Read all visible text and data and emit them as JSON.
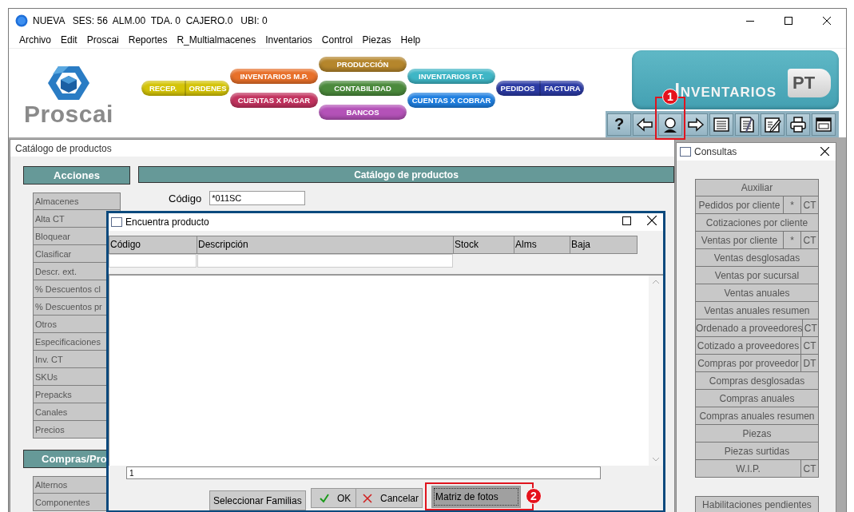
{
  "window": {
    "title": "NUEVA   SES: 56  ALM.00  TDA. 0  CAJERO.0   UBI: 0"
  },
  "menu": [
    "Archivo",
    "Edit",
    "Proscai",
    "Reportes",
    "R_Multialmacenes",
    "Inventarios",
    "Control",
    "Piezas",
    "Help"
  ],
  "logo": {
    "text": "Proscai"
  },
  "module_columns": [
    [
      {
        "labels": [
          "RECEP.",
          "ORDENES"
        ],
        "color": "#d4c408"
      }
    ],
    [
      {
        "labels": [
          "INVENTARIOS M.P."
        ],
        "color": "#e8702a"
      },
      {
        "labels": [
          "CUENTAS X PAGAR"
        ],
        "color": "#c2335f"
      }
    ],
    [
      {
        "labels": [
          "PRODUCCIÓN"
        ],
        "color": "#b5862c"
      },
      {
        "labels": [
          "CONTABILIDAD"
        ],
        "color": "#4b8a3c"
      },
      {
        "labels": [
          "BANCOS"
        ],
        "color": "#b452b8"
      }
    ],
    [
      {
        "labels": [
          "INVENTARIOS P.T."
        ],
        "color": "#3fb6c6"
      },
      {
        "labels": [
          "CUENTAS X COBRAR"
        ],
        "color": "#1f7fe0"
      }
    ],
    [
      {
        "labels": [
          "PEDIDOS",
          "FACTURA"
        ],
        "color": "#2b3aa3"
      }
    ]
  ],
  "banner": {
    "title": "INVENTARIOS",
    "tag": "PT"
  },
  "toolbar_buttons": [
    {
      "kind": "help",
      "glyph": "?"
    },
    {
      "kind": "back"
    },
    {
      "kind": "person",
      "callout": "1"
    },
    {
      "kind": "forward"
    },
    {
      "kind": "list"
    },
    {
      "kind": "document"
    },
    {
      "kind": "edit"
    },
    {
      "kind": "print"
    },
    {
      "kind": "window"
    }
  ],
  "catalog_window": {
    "title": "Catálogo de productos",
    "actions_header": "Acciones",
    "main_header": "Catálogo de productos",
    "actions": [
      "Almacenes",
      "Alta CT",
      "Bloquear",
      "Clasificar",
      "Descr. ext.",
      "% Descuentos cl",
      "% Descuentos pr",
      "Otros",
      "Especificaciones",
      "Inv. CT",
      "SKUs",
      "Prepacks",
      "Canales",
      "Precios"
    ],
    "code_label": "Código",
    "code_value": "*011SC",
    "purchases_header": "Compras/Pro",
    "purchases": [
      "Alternos",
      "Componentes"
    ]
  },
  "dialog": {
    "title": "Encuentra producto",
    "columns": [
      {
        "label": "Código",
        "filter": true
      },
      {
        "label": "Descripción",
        "filter": true
      },
      {
        "label": "Stock",
        "filter": false
      },
      {
        "label": "Alms",
        "filter": false
      },
      {
        "label": "Baja",
        "filter": false
      }
    ],
    "search_value": "1",
    "buttons": [
      {
        "kind": "plain",
        "label": "Seleccionar Familias"
      },
      {
        "kind": "ok",
        "label": "OK"
      },
      {
        "kind": "cancel",
        "label": "Cancelar"
      },
      {
        "kind": "focused",
        "label": "Matriz de fotos",
        "callout": "2"
      }
    ]
  },
  "consultas": {
    "title": "Consultas",
    "items": [
      {
        "label": "Auxiliar"
      },
      {
        "label": "Pedidos por cliente",
        "extras": [
          "*",
          "CT"
        ]
      },
      {
        "label": "Cotizaciones por cliente"
      },
      {
        "label": "Ventas por cliente",
        "extras": [
          "*",
          "CT"
        ]
      },
      {
        "label": "Ventas desglosadas"
      },
      {
        "label": "Ventas por sucursal"
      },
      {
        "label": "Ventas anuales"
      },
      {
        "label": "Ventas anuales resumen"
      },
      {
        "label": "Ordenado a proveedores",
        "extras": [
          "CT"
        ]
      },
      {
        "label": "Cotizado a proveedores",
        "extras": [
          "CT"
        ]
      },
      {
        "label": "Compras por proveedor",
        "extras": [
          "DT"
        ]
      },
      {
        "label": "Compras desglosadas"
      },
      {
        "label": "Compras anuales"
      },
      {
        "label": "Compras anuales resumen"
      },
      {
        "label": "Piezas"
      },
      {
        "label": "Piezas surtidas"
      },
      {
        "label": "W.I.P.",
        "extras": [
          "CT"
        ]
      }
    ],
    "footer_items": [
      "Habilitaciones pendientes"
    ]
  }
}
